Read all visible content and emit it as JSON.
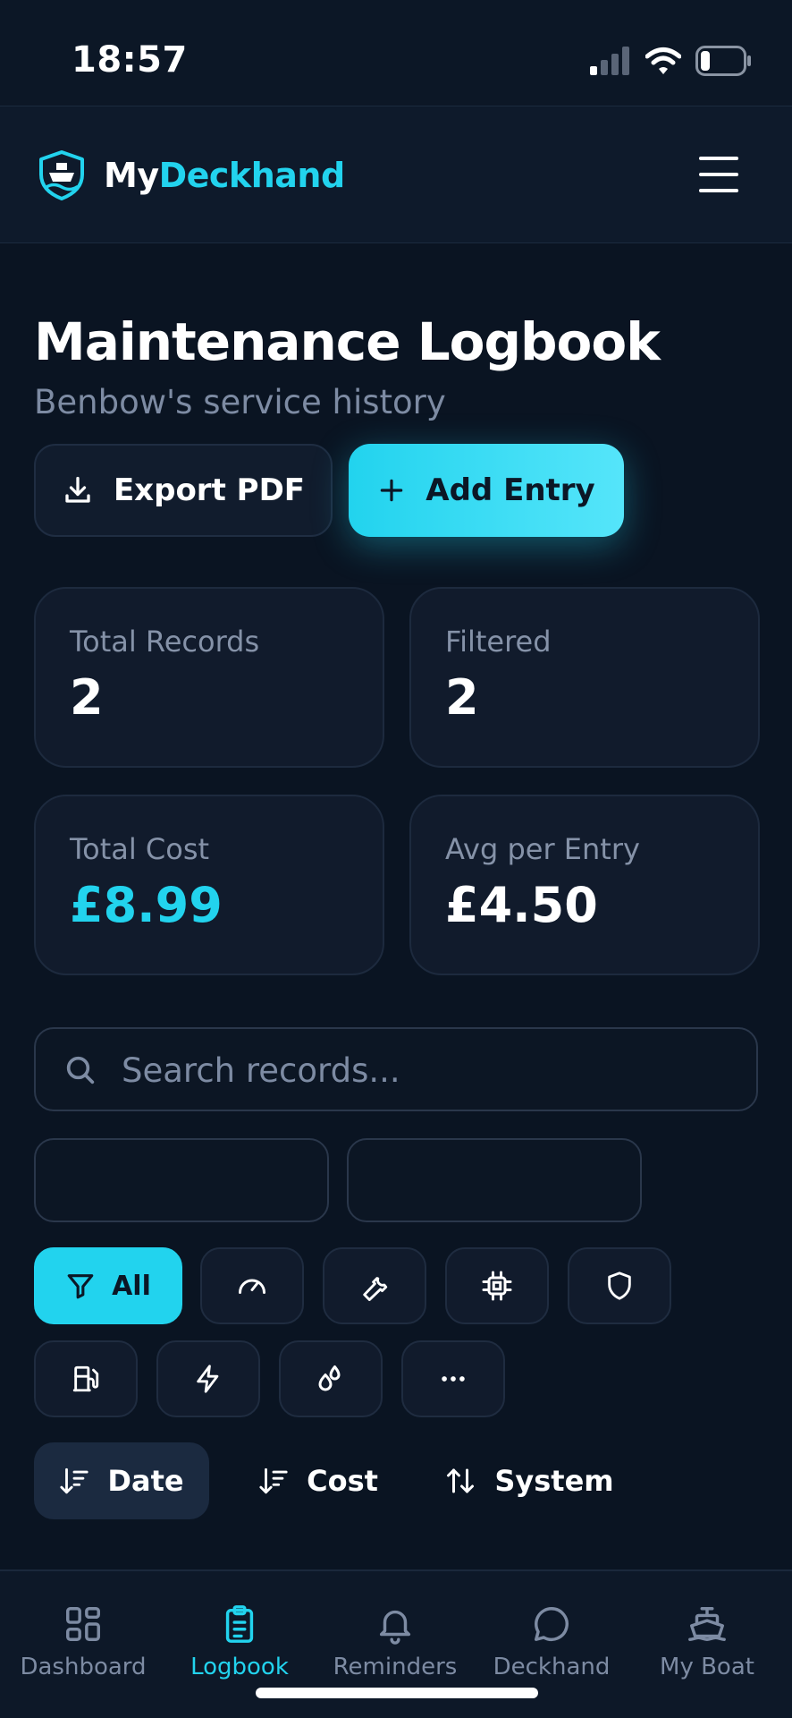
{
  "status_bar": {
    "time": "18:57"
  },
  "header": {
    "brand_prefix": "My",
    "brand_suffix": "Deckhand"
  },
  "page": {
    "title": "Maintenance Logbook",
    "subtitle": "Benbow's service history"
  },
  "actions": {
    "export_label": "Export PDF",
    "add_label": "Add Entry"
  },
  "stats": [
    {
      "label": "Total Records",
      "value": "2"
    },
    {
      "label": "Filtered",
      "value": "2"
    },
    {
      "label": "Total Cost",
      "value": "£8.99"
    },
    {
      "label": "Avg per Entry",
      "value": "£4.50"
    }
  ],
  "search": {
    "placeholder": "Search records...",
    "value": ""
  },
  "filters": {
    "all_label": "All",
    "categories": [
      "gauge-icon",
      "wrench-icon",
      "chip-icon",
      "shield-icon",
      "fuel-icon",
      "bolt-icon",
      "droplets-icon",
      "more-icon"
    ]
  },
  "sort": {
    "date_label": "Date",
    "cost_label": "Cost",
    "system_label": "System",
    "active": "Date"
  },
  "nav": {
    "dashboard": "Dashboard",
    "logbook": "Logbook",
    "reminders": "Reminders",
    "deckhand": "Deckhand",
    "my_boat": "My Boat",
    "active": "Logbook"
  },
  "colors": {
    "accent": "#22d3ee",
    "background": "#0a1422",
    "card": "#111b2c",
    "muted": "#7d8ba3"
  }
}
